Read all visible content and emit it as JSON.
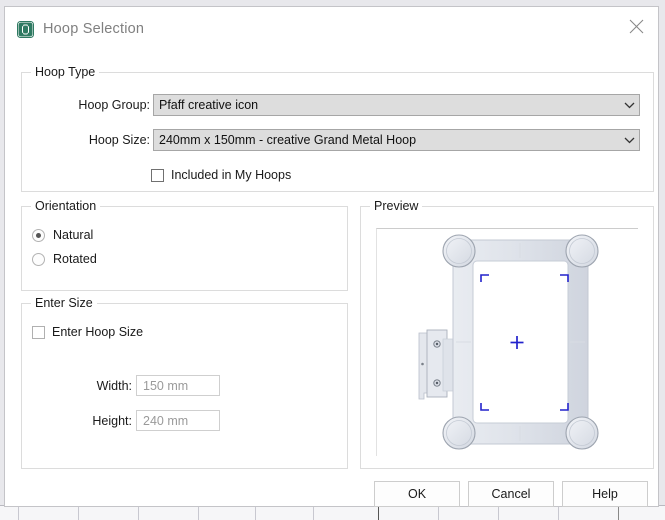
{
  "window": {
    "title": "Hoop Selection",
    "icon": "hoop-icon",
    "close_icon": "close-icon"
  },
  "hoop_type": {
    "legend": "Hoop Type",
    "hoop_group_label": "Hoop Group:",
    "hoop_group_value": "Pfaff creative icon",
    "hoop_size_label": "Hoop Size:",
    "hoop_size_value": "240mm x 150mm - creative Grand Metal Hoop",
    "included_checkbox_label": "Included in My Hoops",
    "included_checked": false,
    "dropdown_icon": "chevron-down-icon"
  },
  "orientation": {
    "legend": "Orientation",
    "options": [
      {
        "label": "Natural",
        "selected": true
      },
      {
        "label": "Rotated",
        "selected": false
      }
    ]
  },
  "enter_size": {
    "legend": "Enter Size",
    "enter_hoop_size_label": "Enter Hoop Size",
    "enter_hoop_size_checked": false,
    "width_label": "Width:",
    "width_value": "150 mm",
    "height_label": "Height:",
    "height_value": "240 mm"
  },
  "preview": {
    "legend": "Preview",
    "center_marker": "crosshair-icon",
    "hoop_graphic": "embroidery-hoop-graphic"
  },
  "buttons": {
    "ok": "OK",
    "cancel": "Cancel",
    "help": "Help"
  },
  "colors": {
    "accent_blue": "#2222cc",
    "hoop_fill": "#dfe2e8",
    "icon_green": "#227a5e",
    "combo_bg": "#dddddd"
  }
}
